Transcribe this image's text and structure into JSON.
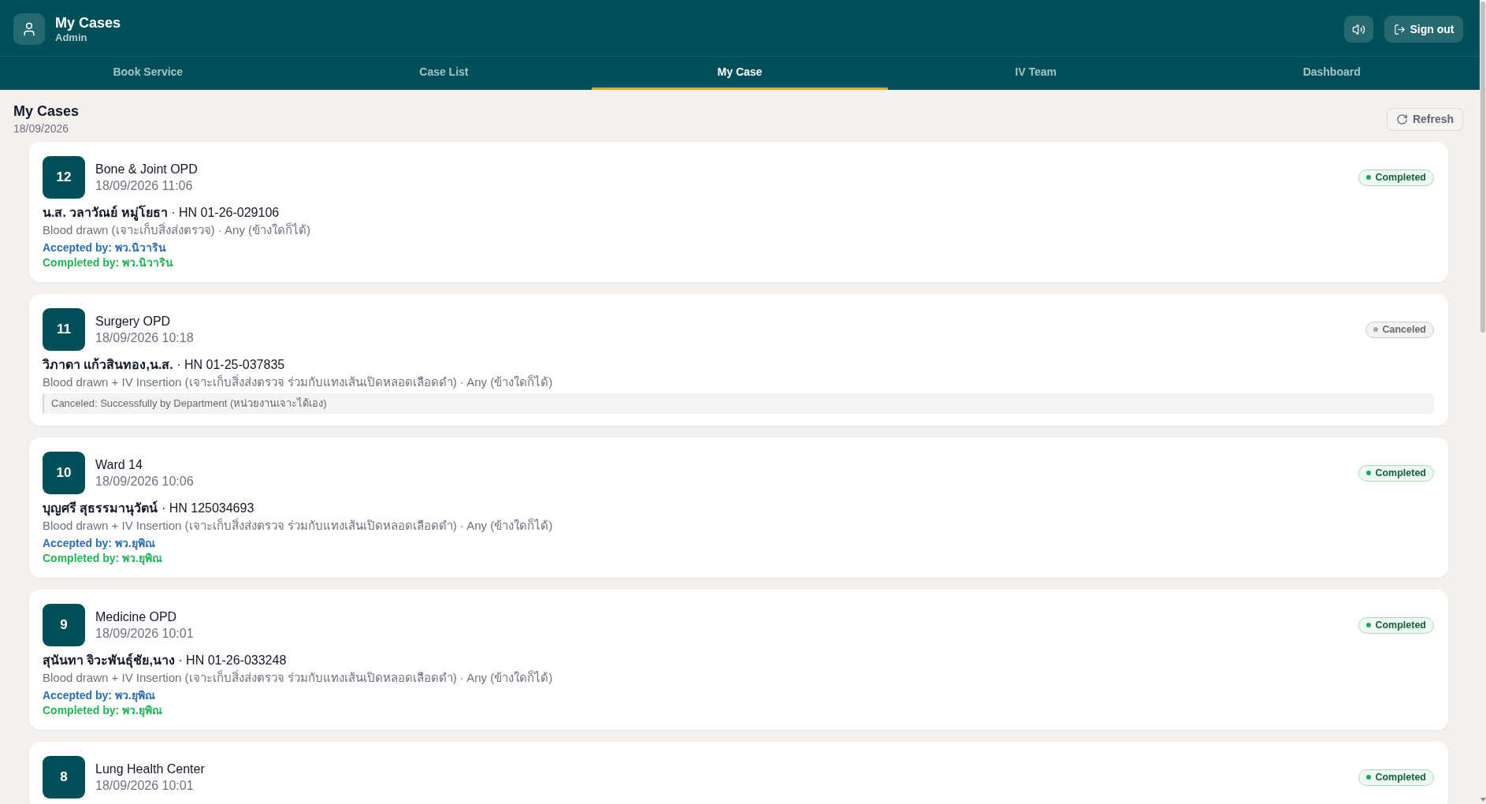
{
  "header": {
    "title": "My Cases",
    "subtitle": "Admin",
    "sign_out": "Sign out"
  },
  "tabs": [
    {
      "label": "Book Service",
      "selected": false
    },
    {
      "label": "Case List",
      "selected": false
    },
    {
      "label": "My Case",
      "selected": true
    },
    {
      "label": "IV Team",
      "selected": false
    },
    {
      "label": "Dashboard",
      "selected": false
    }
  ],
  "page": {
    "title": "My Cases",
    "date": "18/09/2026",
    "refresh": "Refresh"
  },
  "cases": [
    {
      "number": "12",
      "location": "Bone & Joint OPD",
      "time": "18/09/2026 11:06",
      "status": {
        "kind": "completed",
        "label": "Completed"
      },
      "patient": "**น.ส. วลาวัณย์ หมู่โยธา** · HN 01-26-029106",
      "service": "Blood drawn (เจาะเก็บสิ่งส่งตรวจ) · Any (ข้างใดก็ได้)",
      "accepted_by": "Accepted by: พว.นิวาริน",
      "completed_by": "Completed by: พว.นิวาริน"
    },
    {
      "number": "11",
      "location": "Surgery OPD",
      "time": "18/09/2026 10:18",
      "status": {
        "kind": "canceled",
        "label": "Canceled"
      },
      "patient": "**วิภาดา แก้วสินทอง,น.ส.** · HN 01-25-037835",
      "service": "Blood drawn + IV Insertion (เจาะเก็บสิ่งส่งตรวจ ร่วมกับแทงเส้นเปิดหลอดเลือดดำ) · Any (ข้างใดก็ได้)",
      "cancel_note": "Canceled: Successfully by Department (หน่วยงานเจาะได้เอง)"
    },
    {
      "number": "10",
      "location": "Ward 14",
      "time": "18/09/2026 10:06",
      "status": {
        "kind": "completed",
        "label": "Completed"
      },
      "patient": "**บุญศรี สุธรรมานุวัตน์** · HN 125034693",
      "service": "Blood drawn + IV Insertion (เจาะเก็บสิ่งส่งตรวจ ร่วมกับแทงเส้นเปิดหลอดเลือดดำ) · Any (ข้างใดก็ได้)",
      "accepted_by": "Accepted by: พว.ยุพิณ",
      "completed_by": "Completed by: พว.ยุพิณ"
    },
    {
      "number": "9",
      "location": "Medicine OPD",
      "time": "18/09/2026 10:01",
      "status": {
        "kind": "completed",
        "label": "Completed"
      },
      "patient": "**สุนันทา จิวะพันธุ์ชัย,นาง** · HN 01-26-033248",
      "service": "Blood drawn + IV Insertion (เจาะเก็บสิ่งส่งตรวจ ร่วมกับแทงเส้นเปิดหลอดเลือดดำ) · Any (ข้างใดก็ได้)",
      "accepted_by": "Accepted by: พว.ยุพิณ",
      "completed_by": "Completed by: พว.ยุพิณ"
    },
    {
      "number": "8",
      "location": "Lung Health Center",
      "time": "18/09/2026 10:01",
      "status": {
        "kind": "completed",
        "label": "Completed"
      }
    }
  ]
}
